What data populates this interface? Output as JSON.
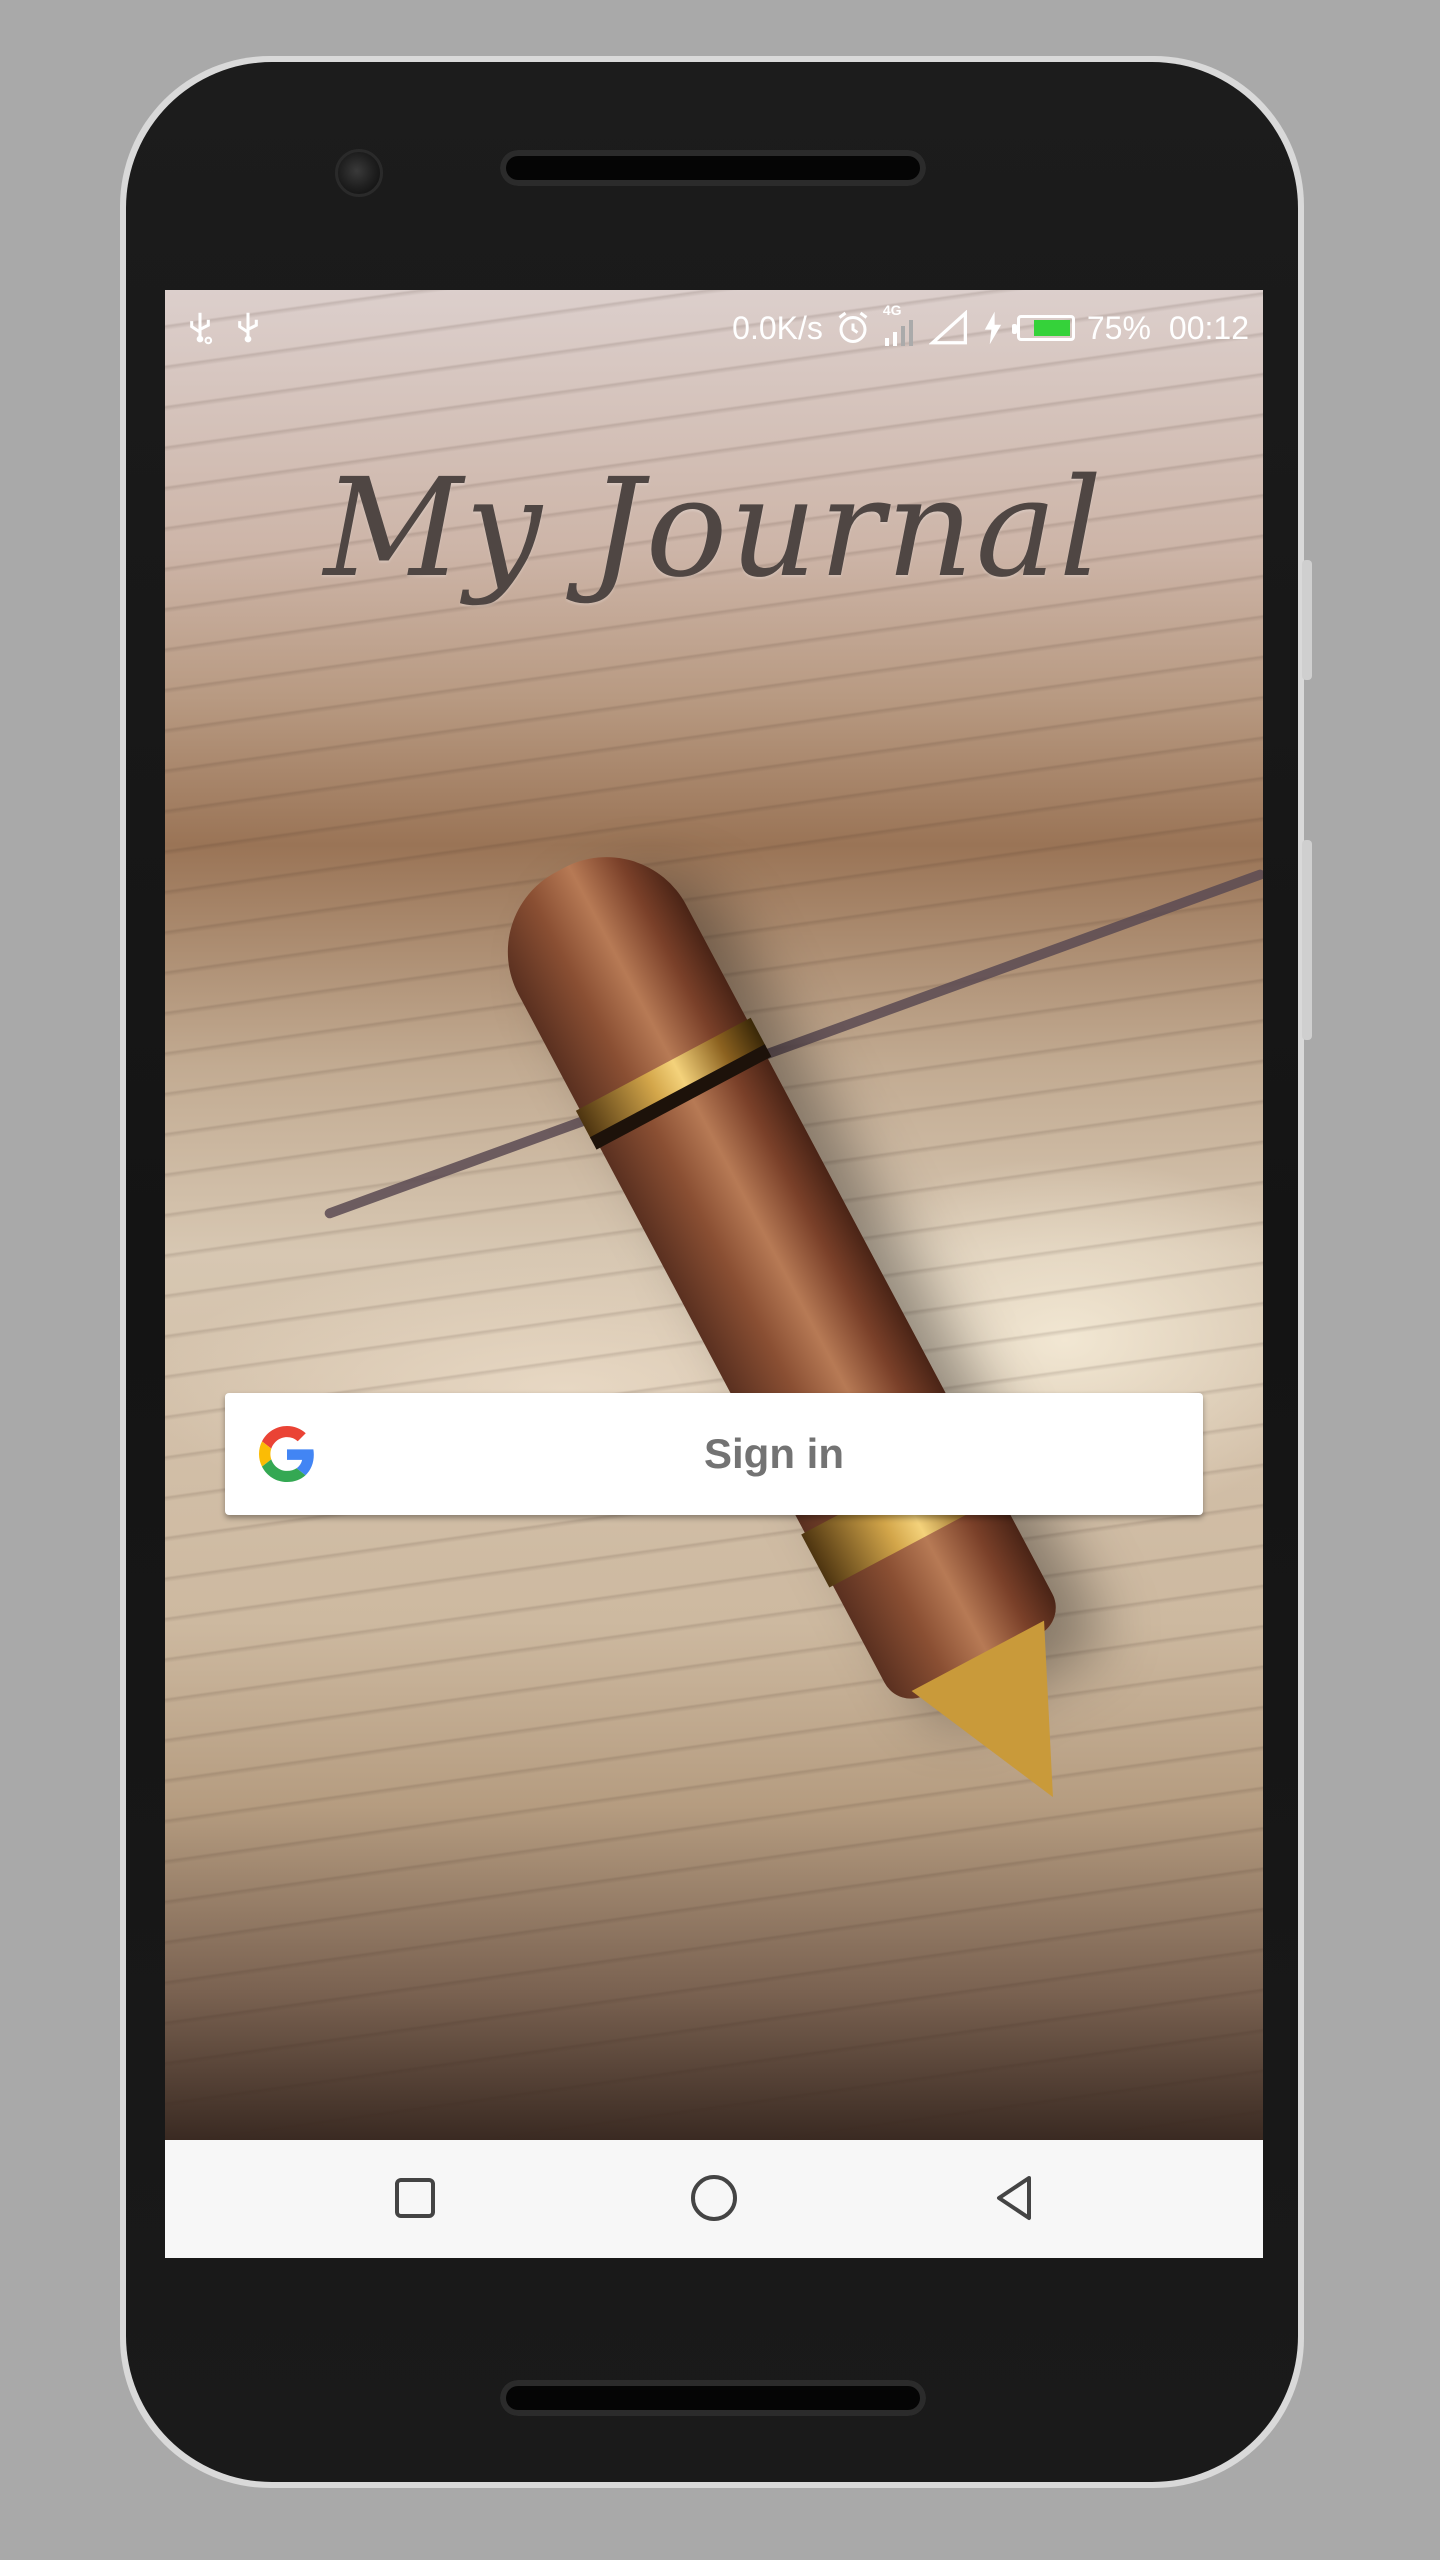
{
  "status_bar": {
    "network_speed": "0.0K/s",
    "network_type": "4G",
    "battery_percent": "75%",
    "battery_level": 0.75,
    "time": "00:12",
    "icons": [
      "usb-debug-icon",
      "usb-icon",
      "alarm-icon",
      "mobile-data-icon",
      "signal-icon",
      "charging-icon",
      "battery-icon"
    ]
  },
  "app": {
    "title": "My Journal",
    "sign_in_label": "Sign in"
  },
  "nav_bar": {
    "icons": [
      "recents-square-icon",
      "home-circle-icon",
      "back-triangle-icon"
    ]
  },
  "colors": {
    "battery_fill": "#35d23a",
    "title_color": "#4f4643",
    "button_text": "#737373",
    "nav_background": "#f7f7f7"
  }
}
